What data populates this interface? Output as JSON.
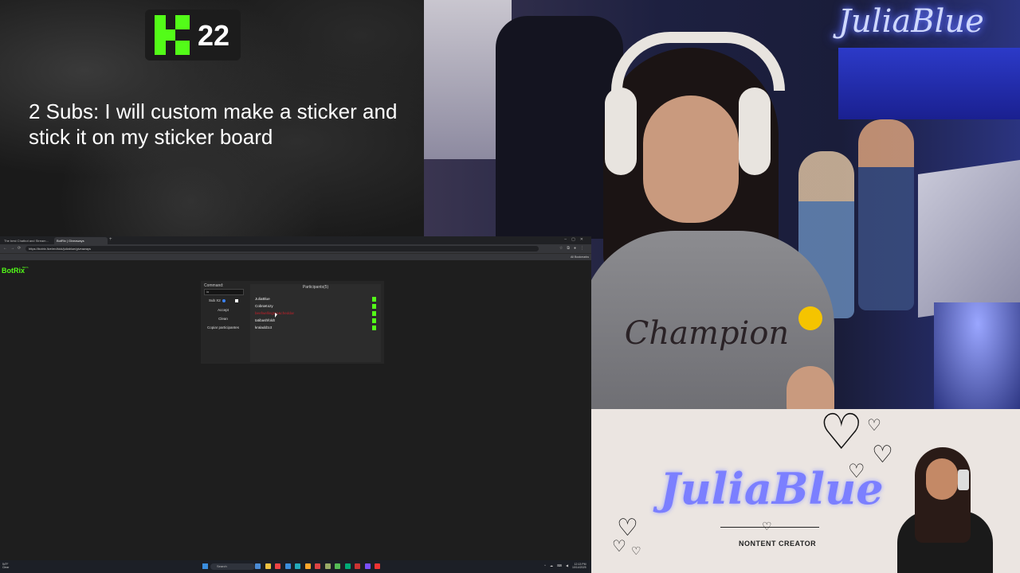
{
  "goal": {
    "platform_icon": "kick-logo-icon",
    "count": "22",
    "text": "2 Subs: I will custom make a sticker and stick it on my sticker board"
  },
  "webcam": {
    "neon_sign": "JuliaBlue",
    "hoodie_text": "Champion"
  },
  "browser": {
    "tabs": [
      {
        "label": "The best Chatbot and Stream..."
      },
      {
        "label": "BotRix | Giveaways"
      }
    ],
    "new_tab": "+",
    "url": "https://botrix.live/en/kick/juliablue/giveaways",
    "bookmarks": [
      {
        "label": "botrix",
        "color": "#53fc18"
      },
      {
        "label": "BotRIX Customizat...",
        "color": "#53fc18"
      },
      {
        "label": "Simple Giveaw...",
        "color": "#9146ff"
      },
      {
        "label": "Tik tok",
        "color": "#ff0050"
      },
      {
        "label": "Instagram",
        "color": "#e1306c"
      },
      {
        "label": "JuliaBlue (@juliabl...",
        "color": "#3b82f6"
      },
      {
        "label": "AutoBoss Stream...",
        "color": "#53fc18"
      },
      {
        "label": "Random Sticker",
        "color": "#888888"
      },
      {
        "label": "Julia Blue's Merch",
        "color": "#888888"
      },
      {
        "label": "my docs",
        "color": "#4285f4"
      },
      {
        "label": "Facebook - Home for Y...",
        "color": "#1877f2"
      },
      {
        "label": "CSGO Zeustattos - acce...",
        "color": "#ea4335"
      },
      {
        "label": "whats dan",
        "color": "#888888"
      },
      {
        "label": "you're board thing",
        "color": "#888888"
      },
      {
        "label": "shrinkpawsawards79...",
        "color": "#888888"
      },
      {
        "label": "The Board is Thing",
        "color": "#888888"
      },
      {
        "label": "canva",
        "color": "#00c4cc"
      },
      {
        "label": "Download the latest...",
        "color": "#ea4335"
      },
      {
        "label": "clip maker",
        "color": "#888888"
      }
    ],
    "all_bookmarks": "All Bookmarks",
    "app": {
      "logo": "BotRix",
      "beta": "BETA",
      "command_label": "Command:",
      "command_value": "/x",
      "sub_label": "Sub X2",
      "buttons": [
        "Accept",
        "Clean",
        "Copiar participantes"
      ],
      "participants_title": "Participants(5)",
      "participants": [
        "JuliaBlue",
        "CobraKozy",
        "beefwellington&cheddar",
        "tatibashfoldt",
        "kraladd1ct"
      ]
    }
  },
  "taskbar": {
    "weather": "54°F",
    "weather_sub": "Clear",
    "search_placeholder": "Search",
    "tray": "^ ☁ ⌨ ◀",
    "time": "12:13 PM",
    "date": "10/14/2025",
    "app_icon_colors": [
      "#4b8bd6",
      "#f0c040",
      "#e44",
      "#3a8dde",
      "#2ab",
      "#ffa62b",
      "#d44",
      "#9a6",
      "#5b5",
      "#0a7",
      "#c33",
      "#7a4fff",
      "#e33"
    ]
  },
  "brand": {
    "name": "JuliaBlue",
    "tagline": "NONTENT CREATOR",
    "accent": "#7b7fff"
  }
}
